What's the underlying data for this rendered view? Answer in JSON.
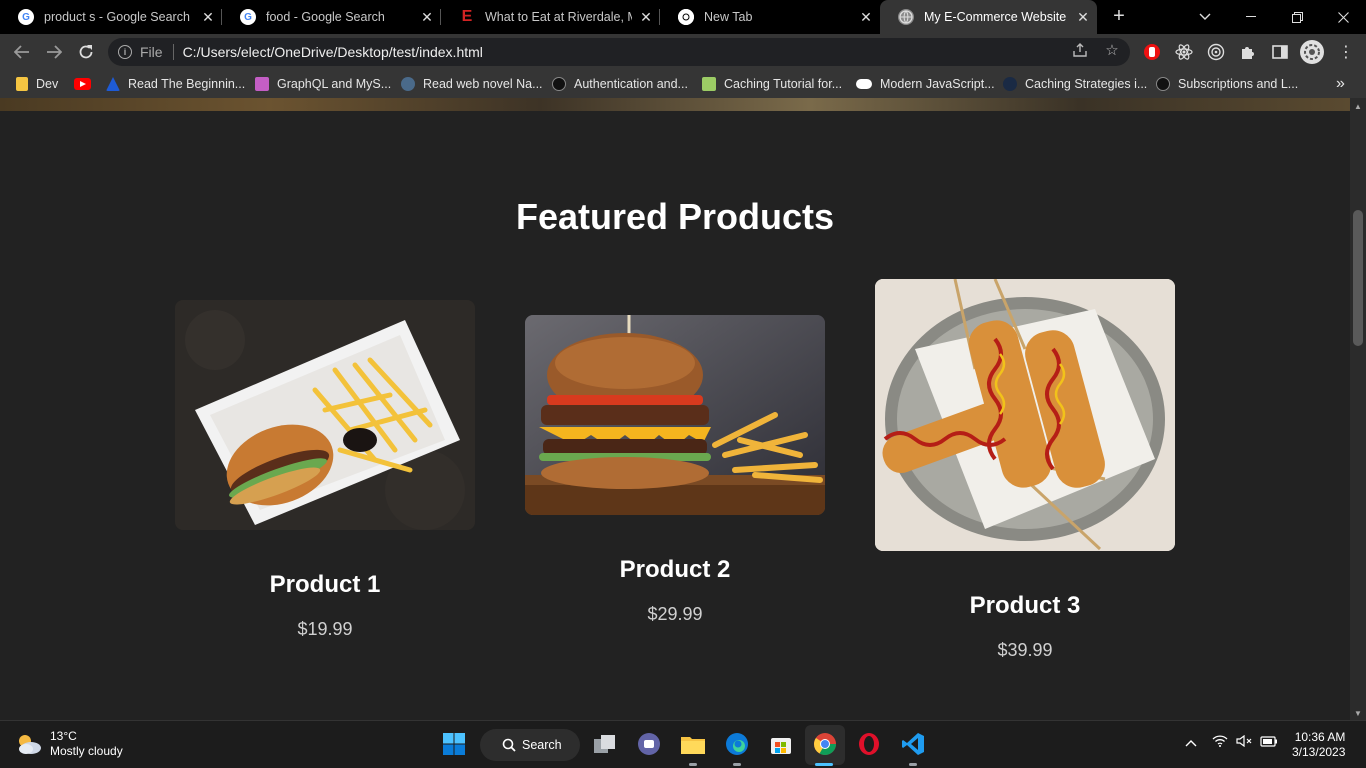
{
  "browser": {
    "tabs": [
      {
        "title": "product s - Google Search",
        "favicon": "google-icon",
        "active": false
      },
      {
        "title": "food - Google Search",
        "favicon": "google-icon",
        "active": false
      },
      {
        "title": "What to Eat at Riverdale, Mar",
        "favicon": "eater-icon",
        "active": false
      },
      {
        "title": "New Tab",
        "favicon": "chrome-icon",
        "active": false
      },
      {
        "title": "My E-Commerce Website",
        "favicon": "globe-icon",
        "active": true
      }
    ],
    "address": {
      "scheme_label": "File",
      "url": "C:/Users/elect/OneDrive/Desktop/test/index.html"
    },
    "bookmarks": [
      {
        "label": "Dev",
        "icon": "folder-icon",
        "color": "#f5c542"
      },
      {
        "label": "",
        "icon": "youtube-icon",
        "color": "#ff0000"
      },
      {
        "label": "Read The Beginnin...",
        "icon": "book-icon",
        "color": "#1e5bd6"
      },
      {
        "label": "GraphQL and MyS...",
        "icon": "graphql-icon",
        "color": "#c45ec5"
      },
      {
        "label": "Read web novel Na...",
        "icon": "novel-icon",
        "color": "#4a6a8a"
      },
      {
        "label": "Authentication and...",
        "icon": "site-icon",
        "color": "#111111"
      },
      {
        "label": "Caching Tutorial for...",
        "icon": "lock-icon",
        "color": "#9ccc65"
      },
      {
        "label": "Modern JavaScript...",
        "icon": "medium-icon",
        "color": "#ffffff"
      },
      {
        "label": "Caching Strategies i...",
        "icon": "site-icon",
        "color": "#1a2a44"
      },
      {
        "label": "Subscriptions and L...",
        "icon": "site-icon",
        "color": "#111111"
      }
    ],
    "more_bookmarks": "»"
  },
  "page": {
    "section_title": "Featured Products",
    "products": [
      {
        "name": "Product 1",
        "price": "$19.99",
        "image": "burger-and-fries-box"
      },
      {
        "name": "Product 2",
        "price": "$29.99",
        "image": "cheeseburger-with-fries"
      },
      {
        "name": "Product 3",
        "price": "$39.99",
        "image": "corn-dogs-with-sauce"
      }
    ]
  },
  "taskbar": {
    "weather": {
      "temp": "13°C",
      "condition": "Mostly cloudy"
    },
    "search_label": "Search",
    "clock": {
      "time": "10:36 AM",
      "date": "3/13/2023"
    }
  },
  "colors": {
    "page_bg": "#222222",
    "tab_active": "#353535",
    "accent_blue": "#4cc2ff"
  }
}
